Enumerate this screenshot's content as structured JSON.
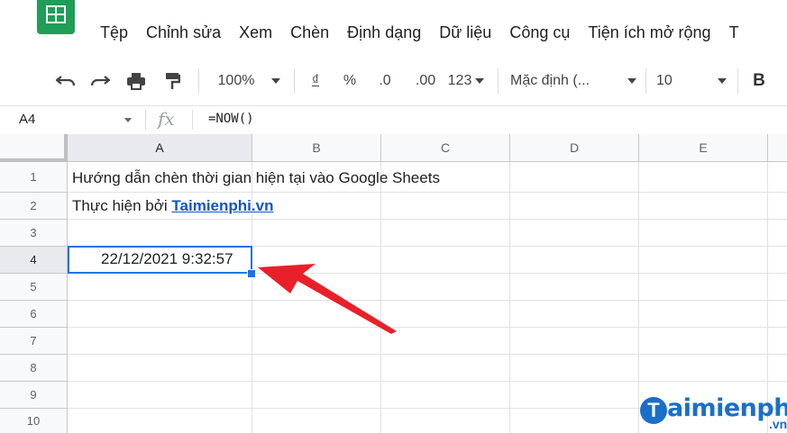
{
  "menu": [
    "Tệp",
    "Chỉnh sửa",
    "Xem",
    "Chèn",
    "Định dạng",
    "Dữ liệu",
    "Công cụ",
    "Tiện ích mở rộng",
    "T"
  ],
  "toolbar": {
    "zoom": "100%",
    "currency": "₫",
    "percent": "%",
    "dec_decrease": ".0",
    "dec_increase": ".00",
    "format_more": "123",
    "font": "Mặc định (...",
    "font_size": "10",
    "bold": "B"
  },
  "formula_bar": {
    "name_box": "A4",
    "fx": "fx",
    "formula": "=NOW()"
  },
  "columns": [
    "A",
    "B",
    "C",
    "D",
    "E"
  ],
  "rows": [
    "1",
    "2",
    "3",
    "4",
    "5",
    "6",
    "7",
    "8",
    "9",
    "10"
  ],
  "cells": {
    "a1": "Hướng dẫn chèn thời gian hiện tại vào Google Sheets",
    "a2_prefix": "Thực hiện bởi",
    "a2_link": "Taimienphi.vn",
    "a4": "22/12/2021 9:32:57"
  },
  "watermark": {
    "text": "aimienphi",
    "suffix": ".vn"
  },
  "colors": {
    "accent": "#1a73e8",
    "arrow": "#e8202a",
    "logo": "#1e9e57",
    "link": "#1155cc"
  }
}
